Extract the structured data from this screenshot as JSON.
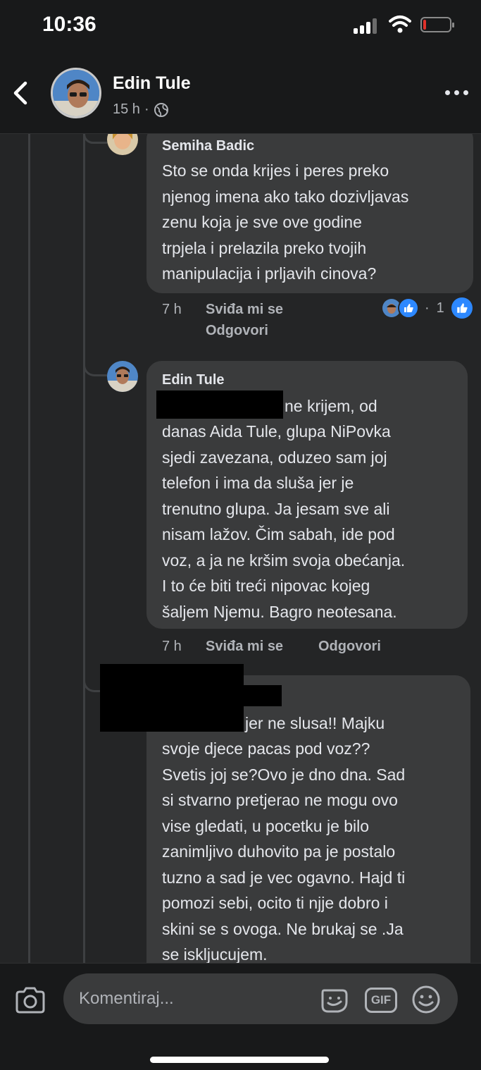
{
  "status_bar": {
    "time": "10:36"
  },
  "header": {
    "name": "Edin Tule",
    "time": "15 h",
    "separator": "·"
  },
  "comments": [
    {
      "author": "Semiha Badic",
      "text": "Sto se onda krijes i peres preko\nnjenog imena ako tako dozivljavas\nzenu koja je sve ove godine\ntrpjela i prelazila preko tvojih\nmanipulacija i prljavih cinova?",
      "time": "7 h",
      "like": "Sviđa mi se",
      "reply": "Odgovori",
      "reaction_count": "1"
    },
    {
      "author": "Edin Tule",
      "text_first": "ne krijem,  od",
      "text": "danas Aida Tule, glupa NiPovka\nsjedi zavezana, oduzeo sam joj\ntelefon i ima da sluša jer je\ntrenutno glupa. Ja jesam sve ali\nnisam lažov. Čim sabah, ide pod\nvoz, a ja ne kršim svoja obećanja.\nI to će biti treći nipovac kojeg\nšaljem Njemu. Bagro neotesana.",
      "time": "7 h",
      "like": "Sviđa mi se",
      "reply": "Odgovori"
    },
    {
      "text_first": "jer ne slusa!! Majku",
      "text": "svoje djece pacas pod  voz??\nSvetis joj se?Ovo je dno dna. Sad\nsi stvarno pretjerao ne mogu ovo\nvise gledati, u pocetku je bilo\nzanimljivo duhovito pa je postalo\ntuzno a sad je vec ogavno. Hajd ti\npomozi sebi, ocito ti njje dobro i\nskini se s ovoga. Ne brukaj se .Ja\nse iskljucujem."
    }
  ],
  "composer": {
    "placeholder": "Komentiraj...",
    "gif_label": "GIF"
  },
  "colors": {
    "background": "#242526",
    "bubble": "#3a3b3c",
    "like_blue": "#2d88ff"
  }
}
